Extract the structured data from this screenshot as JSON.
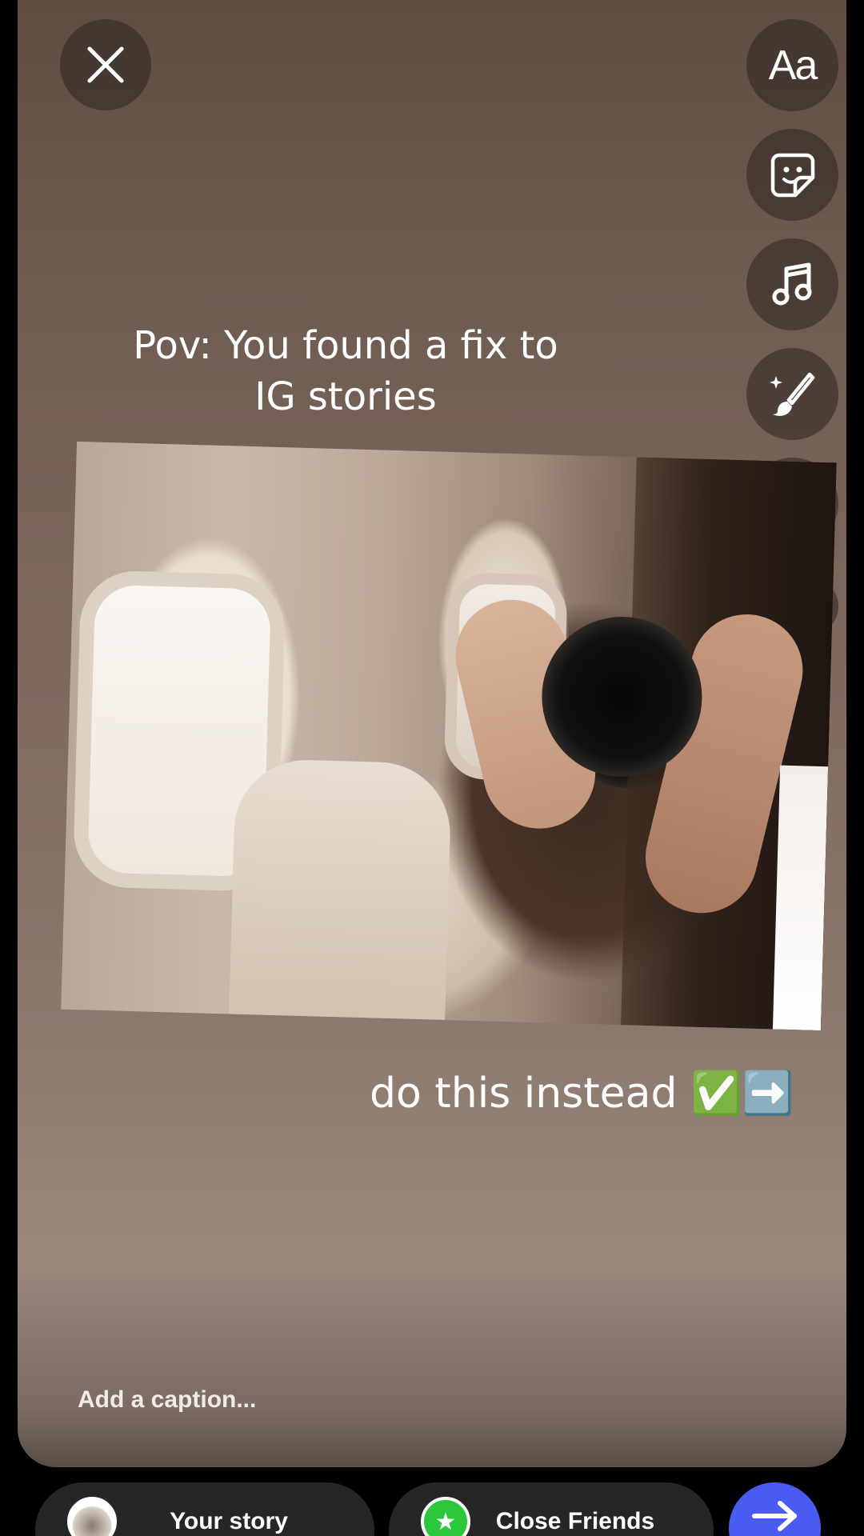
{
  "story_text": {
    "title_line1": "Pov: You found a fix to",
    "title_line2": "IG stories",
    "subtitle": "do this instead ✅➡️"
  },
  "toolbar": {
    "text_tool_label": "Aa",
    "icons": [
      "close-icon",
      "text-icon",
      "sticker-icon",
      "music-icon",
      "draw-icon",
      "effects-icon",
      "chevron-down-icon"
    ]
  },
  "caption": {
    "placeholder": "Add a caption..."
  },
  "share": {
    "your_story_label": "Your story",
    "close_friends_label": "Close Friends"
  },
  "colors": {
    "send_button": "#4a5bf2",
    "close_friends_green": "#2bc83c",
    "pill_background": "#262626"
  }
}
